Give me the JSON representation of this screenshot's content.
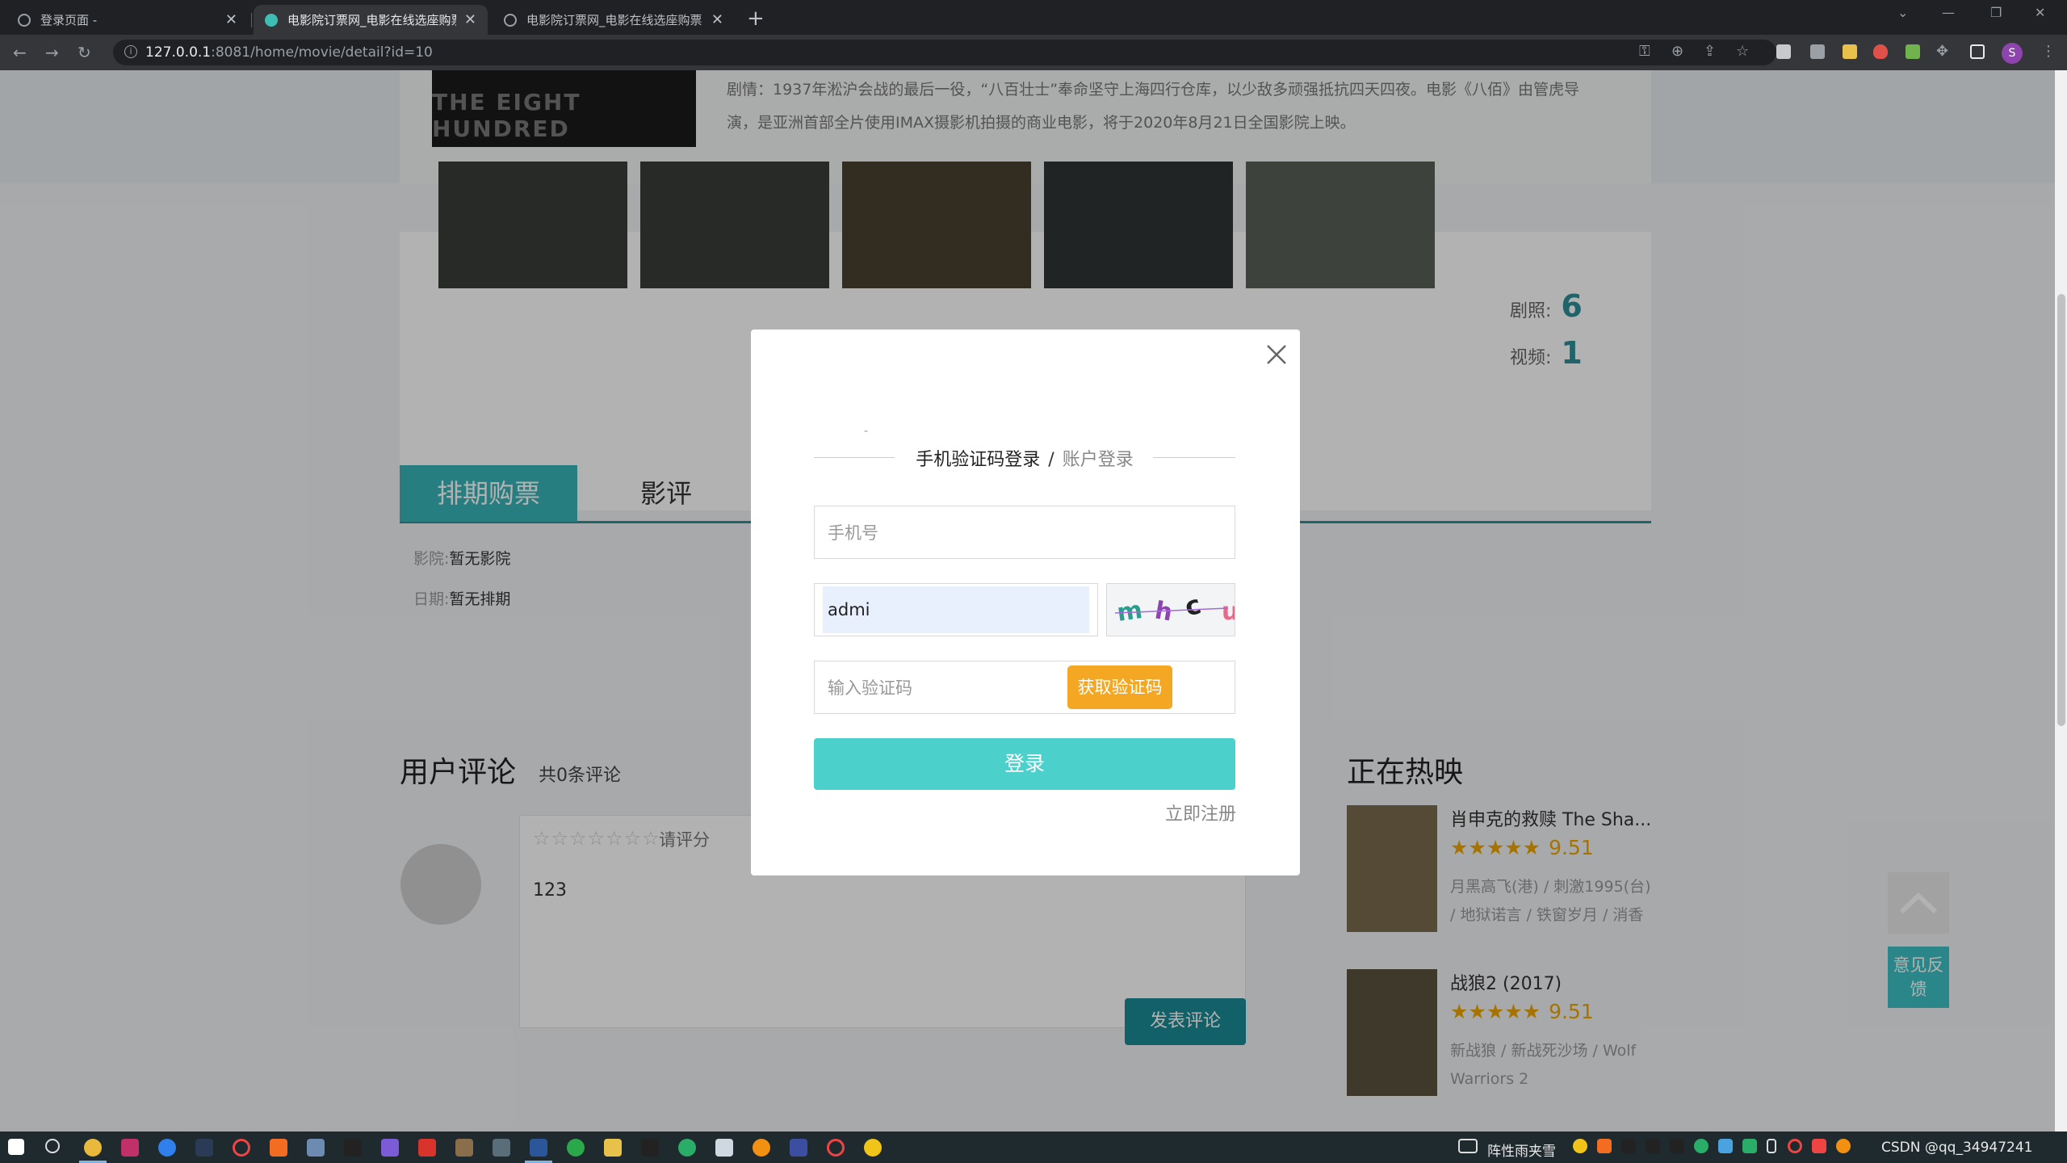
{
  "browser": {
    "tabs": [
      {
        "title": "登录页面 -",
        "active": false
      },
      {
        "title": "电影院订票网_电影在线选座购票",
        "active": true
      },
      {
        "title": "电影院订票网_电影在线选座购票",
        "active": false
      }
    ],
    "url_host": "127.0.0.1",
    "url_path": ":8081/home/movie/detail?id=10",
    "profile_initial": "S"
  },
  "page": {
    "poster_text": "THE EIGHT HUNDRED",
    "plot": "剧情：1937年淞沪会战的最后一役，“八百壮士”奉命坚守上海四行仓库，以少敌多顽强抵抗四天四夜。电影《八佰》由管虎导演，是亚洲首部全片使用IMAX摄影机拍摄的商业电影，将于2020年8月21日全国影院上映。",
    "stills_label": "剧照:",
    "stills_count": "6",
    "videos_label": "视频:",
    "videos_count": "1",
    "tab_schedule": "排期购票",
    "tab_reviews": "影评",
    "cinema_label": "影院:",
    "cinema_value": "暂无影院",
    "date_label": "日期:",
    "date_value": "暂无排期",
    "comments_title": "用户评论",
    "comments_count": "共0条评论",
    "rate_prompt": "请评分",
    "comment_text": "123",
    "post_button": "发表评论",
    "hot_title": "正在热映",
    "movies": [
      {
        "title": "肖申克的救赎 The Sha...",
        "stars": "★★★★★",
        "score": "9.51",
        "desc": "月黑高飞(港) / 刺激1995(台) / 地狱诺言 / 铁窗岁月 / 消香"
      },
      {
        "title": "战狼2 (2017)",
        "stars": "★★★★★",
        "score": "9.51",
        "desc": "新战狼 / 新战死沙场 / Wolf Warriors 2"
      }
    ],
    "feedback": "意见反馈"
  },
  "modal": {
    "dash": "-",
    "mode_phone": "手机验证码登录",
    "mode_sep": "/",
    "mode_account": "账户登录",
    "phone_placeholder": "手机号",
    "captcha_value": "admi",
    "captcha_text": "mhcu",
    "code_placeholder": "输入验证码",
    "get_code": "获取验证码",
    "login": "登录",
    "register": "立即注册"
  },
  "taskbar": {
    "weather": "阵性雨夹雪",
    "tray_text": "CSDN @qq_34947241"
  },
  "colors": {
    "teal": "#38b5b8",
    "login_button": "#4cd0cb",
    "get_code_button": "#f3a722",
    "star": "#f0a500"
  }
}
